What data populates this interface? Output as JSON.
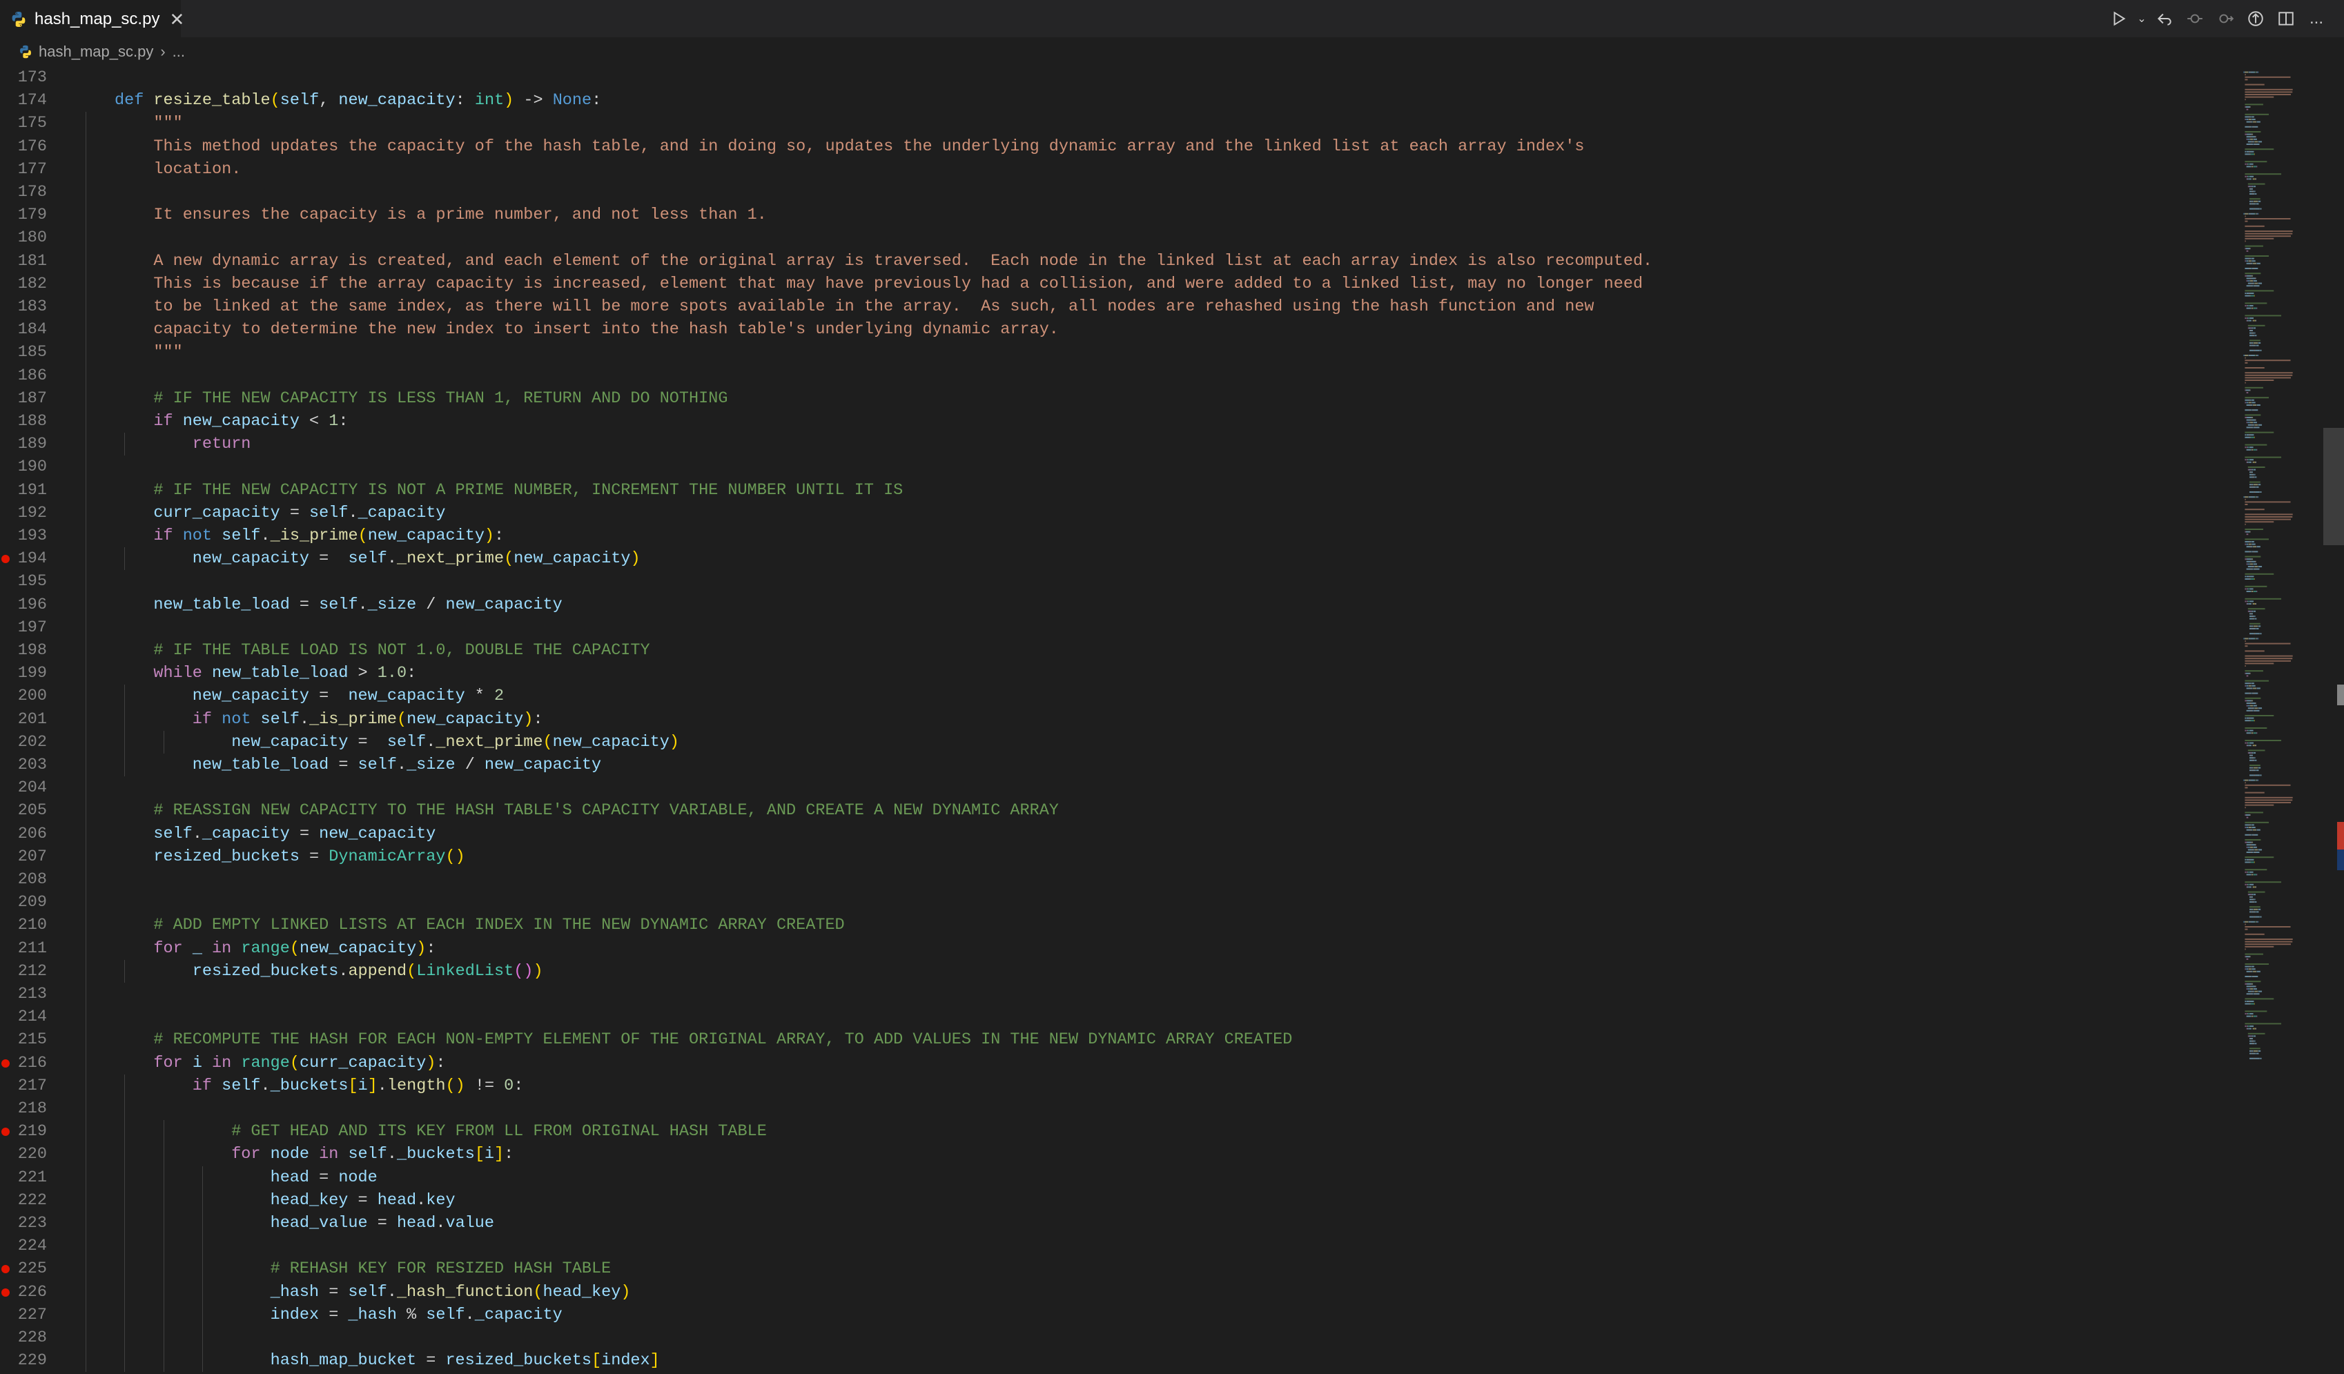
{
  "tab": {
    "title": "hash_map_sc.py",
    "icon": "python-file-icon"
  },
  "breadcrumb": {
    "file": "hash_map_sc.py",
    "more": "..."
  },
  "toolbar": {
    "run": "run-icon",
    "more": "..."
  },
  "colors": {
    "breakpoint": "#e51400",
    "background": "#1e1e1e",
    "tab_bar": "#252526"
  },
  "code": [
    {
      "n": "173",
      "bp": false,
      "indent": 0,
      "tokens": []
    },
    {
      "n": "174",
      "bp": false,
      "indent": 1,
      "tokens": [
        [
          "kw",
          "def "
        ],
        [
          "fn",
          "resize_table"
        ],
        [
          "br1",
          "("
        ],
        [
          "self",
          "self"
        ],
        [
          "op",
          ", "
        ],
        [
          "var",
          "new_capacity"
        ],
        [
          "op",
          ": "
        ],
        [
          "cls",
          "int"
        ],
        [
          "br1",
          ")"
        ],
        [
          "op",
          " -> "
        ],
        [
          "kw",
          "None"
        ],
        [
          "op",
          ":"
        ]
      ]
    },
    {
      "n": "175",
      "bp": false,
      "indent": 2,
      "tokens": [
        [
          "str",
          "\"\"\""
        ]
      ]
    },
    {
      "n": "176",
      "bp": false,
      "indent": 2,
      "tokens": [
        [
          "str",
          "This method updates the capacity of the hash table, and in doing so, updates the underlying dynamic array and the linked list at each array index's"
        ]
      ]
    },
    {
      "n": "177",
      "bp": false,
      "indent": 2,
      "tokens": [
        [
          "str",
          "location."
        ]
      ]
    },
    {
      "n": "178",
      "bp": false,
      "indent": 2,
      "tokens": []
    },
    {
      "n": "179",
      "bp": false,
      "indent": 2,
      "tokens": [
        [
          "str",
          "It ensures the capacity is a prime number, and not less than 1."
        ]
      ]
    },
    {
      "n": "180",
      "bp": false,
      "indent": 2,
      "tokens": []
    },
    {
      "n": "181",
      "bp": false,
      "indent": 2,
      "tokens": [
        [
          "str",
          "A new dynamic array is created, and each element of the original array is traversed.  Each node in the linked list at each array index is also recomputed."
        ]
      ]
    },
    {
      "n": "182",
      "bp": false,
      "indent": 2,
      "tokens": [
        [
          "str",
          "This is because if the array capacity is increased, element that may have previously had a collision, and were added to a linked list, may no longer need"
        ]
      ]
    },
    {
      "n": "183",
      "bp": false,
      "indent": 2,
      "tokens": [
        [
          "str",
          "to be linked at the same index, as there will be more spots available in the array.  As such, all nodes are rehashed using the hash function and new"
        ]
      ]
    },
    {
      "n": "184",
      "bp": false,
      "indent": 2,
      "tokens": [
        [
          "str",
          "capacity to determine the new index to insert into the hash table's underlying dynamic array."
        ]
      ]
    },
    {
      "n": "185",
      "bp": false,
      "indent": 2,
      "tokens": [
        [
          "str",
          "\"\"\""
        ]
      ]
    },
    {
      "n": "186",
      "bp": false,
      "indent": 2,
      "tokens": []
    },
    {
      "n": "187",
      "bp": false,
      "indent": 2,
      "tokens": [
        [
          "cmt",
          "# IF THE NEW CAPACITY IS LESS THAN 1, RETURN AND DO NOTHING"
        ]
      ]
    },
    {
      "n": "188",
      "bp": false,
      "indent": 2,
      "tokens": [
        [
          "ctl",
          "if "
        ],
        [
          "var",
          "new_capacity"
        ],
        [
          "op",
          " < "
        ],
        [
          "num",
          "1"
        ],
        [
          "op",
          ":"
        ]
      ]
    },
    {
      "n": "189",
      "bp": false,
      "indent": 3,
      "tokens": [
        [
          "ctl",
          "return"
        ]
      ]
    },
    {
      "n": "190",
      "bp": false,
      "indent": 2,
      "tokens": []
    },
    {
      "n": "191",
      "bp": false,
      "indent": 2,
      "tokens": [
        [
          "cmt",
          "# IF THE NEW CAPACITY IS NOT A PRIME NUMBER, INCREMENT THE NUMBER UNTIL IT IS"
        ]
      ]
    },
    {
      "n": "192",
      "bp": false,
      "indent": 2,
      "tokens": [
        [
          "var",
          "curr_capacity"
        ],
        [
          "op",
          " = "
        ],
        [
          "self",
          "self"
        ],
        [
          "op",
          "."
        ],
        [
          "var",
          "_capacity"
        ]
      ]
    },
    {
      "n": "193",
      "bp": false,
      "indent": 2,
      "tokens": [
        [
          "ctl",
          "if "
        ],
        [
          "kw",
          "not "
        ],
        [
          "self",
          "self"
        ],
        [
          "op",
          "."
        ],
        [
          "fn",
          "_is_prime"
        ],
        [
          "br1",
          "("
        ],
        [
          "var",
          "new_capacity"
        ],
        [
          "br1",
          ")"
        ],
        [
          "op",
          ":"
        ]
      ]
    },
    {
      "n": "194",
      "bp": true,
      "indent": 3,
      "tokens": [
        [
          "var",
          "new_capacity"
        ],
        [
          "op",
          " =  "
        ],
        [
          "self",
          "self"
        ],
        [
          "op",
          "."
        ],
        [
          "fn",
          "_next_prime"
        ],
        [
          "br1",
          "("
        ],
        [
          "var",
          "new_capacity"
        ],
        [
          "br1",
          ")"
        ]
      ]
    },
    {
      "n": "195",
      "bp": false,
      "indent": 2,
      "tokens": []
    },
    {
      "n": "196",
      "bp": false,
      "indent": 2,
      "tokens": [
        [
          "var",
          "new_table_load"
        ],
        [
          "op",
          " = "
        ],
        [
          "self",
          "self"
        ],
        [
          "op",
          "."
        ],
        [
          "var",
          "_size"
        ],
        [
          "op",
          " / "
        ],
        [
          "var",
          "new_capacity"
        ]
      ]
    },
    {
      "n": "197",
      "bp": false,
      "indent": 2,
      "tokens": []
    },
    {
      "n": "198",
      "bp": false,
      "indent": 2,
      "tokens": [
        [
          "cmt",
          "# IF THE TABLE LOAD IS NOT 1.0, DOUBLE THE CAPACITY"
        ]
      ]
    },
    {
      "n": "199",
      "bp": false,
      "indent": 2,
      "tokens": [
        [
          "ctl",
          "while "
        ],
        [
          "var",
          "new_table_load"
        ],
        [
          "op",
          " > "
        ],
        [
          "num",
          "1.0"
        ],
        [
          "op",
          ":"
        ]
      ]
    },
    {
      "n": "200",
      "bp": false,
      "indent": 3,
      "tokens": [
        [
          "var",
          "new_capacity"
        ],
        [
          "op",
          " =  "
        ],
        [
          "var",
          "new_capacity"
        ],
        [
          "op",
          " * "
        ],
        [
          "num",
          "2"
        ]
      ]
    },
    {
      "n": "201",
      "bp": false,
      "indent": 3,
      "tokens": [
        [
          "ctl",
          "if "
        ],
        [
          "kw",
          "not "
        ],
        [
          "self",
          "self"
        ],
        [
          "op",
          "."
        ],
        [
          "fn",
          "_is_prime"
        ],
        [
          "br1",
          "("
        ],
        [
          "var",
          "new_capacity"
        ],
        [
          "br1",
          ")"
        ],
        [
          "op",
          ":"
        ]
      ]
    },
    {
      "n": "202",
      "bp": false,
      "indent": 4,
      "tokens": [
        [
          "var",
          "new_capacity"
        ],
        [
          "op",
          " =  "
        ],
        [
          "self",
          "self"
        ],
        [
          "op",
          "."
        ],
        [
          "fn",
          "_next_prime"
        ],
        [
          "br1",
          "("
        ],
        [
          "var",
          "new_capacity"
        ],
        [
          "br1",
          ")"
        ]
      ]
    },
    {
      "n": "203",
      "bp": false,
      "indent": 3,
      "tokens": [
        [
          "var",
          "new_table_load"
        ],
        [
          "op",
          " = "
        ],
        [
          "self",
          "self"
        ],
        [
          "op",
          "."
        ],
        [
          "var",
          "_size"
        ],
        [
          "op",
          " / "
        ],
        [
          "var",
          "new_capacity"
        ]
      ]
    },
    {
      "n": "204",
      "bp": false,
      "indent": 2,
      "tokens": []
    },
    {
      "n": "205",
      "bp": false,
      "indent": 2,
      "tokens": [
        [
          "cmt",
          "# REASSIGN NEW CAPACITY TO THE HASH TABLE'S CAPACITY VARIABLE, AND CREATE A NEW DYNAMIC ARRAY"
        ]
      ]
    },
    {
      "n": "206",
      "bp": false,
      "indent": 2,
      "tokens": [
        [
          "self",
          "self"
        ],
        [
          "op",
          "."
        ],
        [
          "var",
          "_capacity"
        ],
        [
          "op",
          " = "
        ],
        [
          "var",
          "new_capacity"
        ]
      ]
    },
    {
      "n": "207",
      "bp": false,
      "indent": 2,
      "tokens": [
        [
          "var",
          "resized_buckets"
        ],
        [
          "op",
          " = "
        ],
        [
          "cls",
          "DynamicArray"
        ],
        [
          "br1",
          "()"
        ]
      ]
    },
    {
      "n": "208",
      "bp": false,
      "indent": 2,
      "tokens": []
    },
    {
      "n": "209",
      "bp": false,
      "indent": 2,
      "tokens": []
    },
    {
      "n": "210",
      "bp": false,
      "indent": 2,
      "tokens": [
        [
          "cmt",
          "# ADD EMPTY LINKED LISTS AT EACH INDEX IN THE NEW DYNAMIC ARRAY CREATED"
        ]
      ]
    },
    {
      "n": "211",
      "bp": false,
      "indent": 2,
      "tokens": [
        [
          "ctl",
          "for "
        ],
        [
          "var",
          "_"
        ],
        [
          "ctl",
          " in "
        ],
        [
          "cls",
          "range"
        ],
        [
          "br1",
          "("
        ],
        [
          "var",
          "new_capacity"
        ],
        [
          "br1",
          ")"
        ],
        [
          "op",
          ":"
        ]
      ]
    },
    {
      "n": "212",
      "bp": false,
      "indent": 3,
      "tokens": [
        [
          "var",
          "resized_buckets"
        ],
        [
          "op",
          "."
        ],
        [
          "fn",
          "append"
        ],
        [
          "br1",
          "("
        ],
        [
          "cls",
          "LinkedList"
        ],
        [
          "br2",
          "()"
        ],
        [
          "br1",
          ")"
        ]
      ]
    },
    {
      "n": "213",
      "bp": false,
      "indent": 2,
      "tokens": []
    },
    {
      "n": "214",
      "bp": false,
      "indent": 2,
      "tokens": []
    },
    {
      "n": "215",
      "bp": false,
      "indent": 2,
      "tokens": [
        [
          "cmt",
          "# RECOMPUTE THE HASH FOR EACH NON-EMPTY ELEMENT OF THE ORIGINAL ARRAY, TO ADD VALUES IN THE NEW DYNAMIC ARRAY CREATED"
        ]
      ]
    },
    {
      "n": "216",
      "bp": true,
      "indent": 2,
      "tokens": [
        [
          "ctl",
          "for "
        ],
        [
          "var",
          "i"
        ],
        [
          "ctl",
          " in "
        ],
        [
          "cls",
          "range"
        ],
        [
          "br1",
          "("
        ],
        [
          "var",
          "curr_capacity"
        ],
        [
          "br1",
          ")"
        ],
        [
          "op",
          ":"
        ]
      ]
    },
    {
      "n": "217",
      "bp": false,
      "indent": 3,
      "tokens": [
        [
          "ctl",
          "if "
        ],
        [
          "self",
          "self"
        ],
        [
          "op",
          "."
        ],
        [
          "var",
          "_buckets"
        ],
        [
          "br1",
          "["
        ],
        [
          "var",
          "i"
        ],
        [
          "br1",
          "]"
        ],
        [
          "op",
          "."
        ],
        [
          "fn",
          "length"
        ],
        [
          "br1",
          "()"
        ],
        [
          "op",
          " != "
        ],
        [
          "num",
          "0"
        ],
        [
          "op",
          ":"
        ]
      ]
    },
    {
      "n": "218",
      "bp": false,
      "indent": 3,
      "tokens": []
    },
    {
      "n": "219",
      "bp": true,
      "indent": 4,
      "tokens": [
        [
          "cmt",
          "# GET HEAD AND ITS KEY FROM LL FROM ORIGINAL HASH TABLE"
        ]
      ]
    },
    {
      "n": "220",
      "bp": false,
      "indent": 4,
      "tokens": [
        [
          "ctl",
          "for "
        ],
        [
          "var",
          "node"
        ],
        [
          "ctl",
          " in "
        ],
        [
          "self",
          "self"
        ],
        [
          "op",
          "."
        ],
        [
          "var",
          "_buckets"
        ],
        [
          "br1",
          "["
        ],
        [
          "var",
          "i"
        ],
        [
          "br1",
          "]"
        ],
        [
          "op",
          ":"
        ]
      ]
    },
    {
      "n": "221",
      "bp": false,
      "indent": 5,
      "tokens": [
        [
          "var",
          "head"
        ],
        [
          "op",
          " = "
        ],
        [
          "var",
          "node"
        ]
      ]
    },
    {
      "n": "222",
      "bp": false,
      "indent": 5,
      "tokens": [
        [
          "var",
          "head_key"
        ],
        [
          "op",
          " = "
        ],
        [
          "var",
          "head"
        ],
        [
          "op",
          "."
        ],
        [
          "var",
          "key"
        ]
      ]
    },
    {
      "n": "223",
      "bp": false,
      "indent": 5,
      "tokens": [
        [
          "var",
          "head_value"
        ],
        [
          "op",
          " = "
        ],
        [
          "var",
          "head"
        ],
        [
          "op",
          "."
        ],
        [
          "var",
          "value"
        ]
      ]
    },
    {
      "n": "224",
      "bp": false,
      "indent": 5,
      "tokens": []
    },
    {
      "n": "225",
      "bp": true,
      "indent": 5,
      "tokens": [
        [
          "cmt",
          "# REHASH KEY FOR RESIZED HASH TABLE"
        ]
      ]
    },
    {
      "n": "226",
      "bp": true,
      "indent": 5,
      "tokens": [
        [
          "var",
          "_hash"
        ],
        [
          "op",
          " = "
        ],
        [
          "self",
          "self"
        ],
        [
          "op",
          "."
        ],
        [
          "fn",
          "_hash_function"
        ],
        [
          "br1",
          "("
        ],
        [
          "var",
          "head_key"
        ],
        [
          "br1",
          ")"
        ]
      ]
    },
    {
      "n": "227",
      "bp": false,
      "indent": 5,
      "tokens": [
        [
          "var",
          "index"
        ],
        [
          "op",
          " = "
        ],
        [
          "var",
          "_hash"
        ],
        [
          "op",
          " % "
        ],
        [
          "self",
          "self"
        ],
        [
          "op",
          "."
        ],
        [
          "var",
          "_capacity"
        ]
      ]
    },
    {
      "n": "228",
      "bp": false,
      "indent": 5,
      "tokens": []
    },
    {
      "n": "229",
      "bp": false,
      "indent": 5,
      "tokens": [
        [
          "var",
          "hash_map_bucket"
        ],
        [
          "op",
          " = "
        ],
        [
          "var",
          "resized_buckets"
        ],
        [
          "br1",
          "["
        ],
        [
          "var",
          "index"
        ],
        [
          "br1",
          "]"
        ]
      ]
    }
  ]
}
